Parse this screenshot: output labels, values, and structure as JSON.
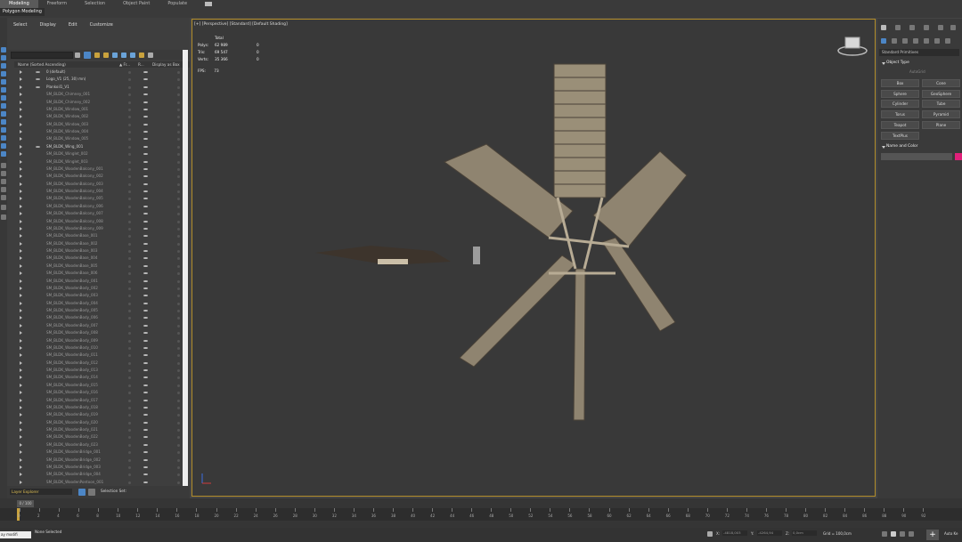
{
  "ribbon": {
    "tabs": [
      "Modeling",
      "Freeform",
      "Selection",
      "Object Paint",
      "Populate"
    ],
    "sub_label": "Polygon Modeling"
  },
  "explorer": {
    "menu": [
      "Select",
      "Display",
      "Edit",
      "Customize"
    ],
    "columns": {
      "name": "Name (Sorted Ascending)",
      "c1": "▲ Fr...",
      "c2": "R...",
      "c3": "Display as Box"
    },
    "rows": [
      {
        "name": "0 (default)",
        "bright": true,
        "arrow": true,
        "eye": true
      },
      {
        "name": "Logo_V1 (25, 30) mn)",
        "bright": true,
        "arrow": true,
        "eye": true
      },
      {
        "name": "Plankoil1_V1",
        "bright": true,
        "arrow": true,
        "eye": true
      },
      {
        "name": "SM_BLDK_Chimney_001"
      },
      {
        "name": "SM_BLDK_Chimney_002"
      },
      {
        "name": "SM_BLDK_Window_001"
      },
      {
        "name": "SM_BLDK_Window_002"
      },
      {
        "name": "SM_BLDK_Window_003"
      },
      {
        "name": "SM_BLDK_Window_004"
      },
      {
        "name": "SM_BLDK_Window_005"
      },
      {
        "name": "SM_BLDK_Wing_001",
        "bright": true,
        "eye": true
      },
      {
        "name": "SM_BLDK_Winglet_002"
      },
      {
        "name": "SM_BLDK_Winglet_003"
      },
      {
        "name": "SM_BLDK_WoodenBalcony_001"
      },
      {
        "name": "SM_BLDK_WoodenBalcony_002"
      },
      {
        "name": "SM_BLDK_WoodenBalcony_003"
      },
      {
        "name": "SM_BLDK_WoodenBalcony_004"
      },
      {
        "name": "SM_BLDK_WoodenBalcony_005"
      },
      {
        "name": "SM_BLDK_WoodenBalcony_006"
      },
      {
        "name": "SM_BLDK_WoodenBalcony_007"
      },
      {
        "name": "SM_BLDK_WoodenBalcony_008"
      },
      {
        "name": "SM_BLDK_WoodenBalcony_009"
      },
      {
        "name": "SM_BLDK_WoodenBase_001"
      },
      {
        "name": "SM_BLDK_WoodenBase_002"
      },
      {
        "name": "SM_BLDK_WoodenBase_003"
      },
      {
        "name": "SM_BLDK_WoodenBase_004"
      },
      {
        "name": "SM_BLDK_WoodenBase_005"
      },
      {
        "name": "SM_BLDK_WoodenBase_006"
      },
      {
        "name": "SM_BLDK_WoodenBody_001"
      },
      {
        "name": "SM_BLDK_WoodenBody_002"
      },
      {
        "name": "SM_BLDK_WoodenBody_003"
      },
      {
        "name": "SM_BLDK_WoodenBody_004"
      },
      {
        "name": "SM_BLDK_WoodenBody_005"
      },
      {
        "name": "SM_BLDK_WoodenBody_006"
      },
      {
        "name": "SM_BLDK_WoodenBody_007"
      },
      {
        "name": "SM_BLDK_WoodenBody_008"
      },
      {
        "name": "SM_BLDK_WoodenBody_009"
      },
      {
        "name": "SM_BLDK_WoodenBody_010"
      },
      {
        "name": "SM_BLDK_WoodenBody_011"
      },
      {
        "name": "SM_BLDK_WoodenBody_012"
      },
      {
        "name": "SM_BLDK_WoodenBody_013"
      },
      {
        "name": "SM_BLDK_WoodenBody_014"
      },
      {
        "name": "SM_BLDK_WoodenBody_015"
      },
      {
        "name": "SM_BLDK_WoodenBody_016"
      },
      {
        "name": "SM_BLDK_WoodenBody_017"
      },
      {
        "name": "SM_BLDK_WoodenBody_018"
      },
      {
        "name": "SM_BLDK_WoodenBody_019"
      },
      {
        "name": "SM_BLDK_WoodenBody_020"
      },
      {
        "name": "SM_BLDK_WoodenBody_021"
      },
      {
        "name": "SM_BLDK_WoodenBody_022"
      },
      {
        "name": "SM_BLDK_WoodenBody_023"
      },
      {
        "name": "SM_BLDK_WoodenBridge_001"
      },
      {
        "name": "SM_BLDK_WoodenBridge_002"
      },
      {
        "name": "SM_BLDK_WoodenBridge_003"
      },
      {
        "name": "SM_BLDK_WoodenBridge_004"
      },
      {
        "name": "SM_BLDK_WoodenPontoon_001"
      },
      {
        "name": "SM_BLDK_WoodenPontoon_002"
      },
      {
        "name": "SM_BLDK_WoodenRoof_001"
      }
    ],
    "bottom_left": "Layer Explorer",
    "bottom_right": "Selection Set:"
  },
  "viewport": {
    "label": "[+] [Perspective] [Standard] [Default Shading]",
    "stats_header": "Total",
    "stats": [
      {
        "k": "Polys:",
        "v": "62 989",
        "z": "0"
      },
      {
        "k": "Tris:",
        "v": "69 547",
        "z": "0"
      },
      {
        "k": "Verts:",
        "v": "35 366",
        "z": "0"
      }
    ],
    "fps_label": "FPS:",
    "fps_value": "73"
  },
  "command_panel": {
    "dropdown": "Standard Primitives",
    "object_type": "Object Type",
    "autogrid": "AutoGrid",
    "buttons": [
      "Box",
      "Cone",
      "Sphere",
      "GeoSphere",
      "Cylinder",
      "Tube",
      "Torus",
      "Pyramid",
      "Teapot",
      "Plane",
      "TextPlus"
    ],
    "name_and_color": "Name and Color",
    "swatch_color": "#e0207a"
  },
  "timeline": {
    "slider": "0 / 100",
    "ticks": [
      "0",
      "2",
      "4",
      "6",
      "8",
      "10",
      "12",
      "14",
      "16",
      "18",
      "20",
      "22",
      "24",
      "26",
      "28",
      "30",
      "32",
      "34",
      "36",
      "38",
      "40",
      "42",
      "44",
      "46",
      "48",
      "50",
      "52",
      "54",
      "56",
      "58",
      "60",
      "62",
      "64",
      "66",
      "68",
      "70",
      "72",
      "74",
      "76",
      "78",
      "80",
      "82",
      "84",
      "86",
      "88",
      "90",
      "92"
    ]
  },
  "status": {
    "left_input": "ay modifi",
    "selection": "None Selected",
    "x_label": "X:",
    "x_value": "-4818,003",
    "y_label": "Y:",
    "y_value": "-4264,94",
    "z_label": "Z:",
    "z_value": "0,0cm",
    "grid": "Grid = 100,0cm",
    "autokey": "Auto Ke"
  },
  "colors": {
    "viewport_border": "#b28d2a",
    "accent": "#4c86c6"
  }
}
